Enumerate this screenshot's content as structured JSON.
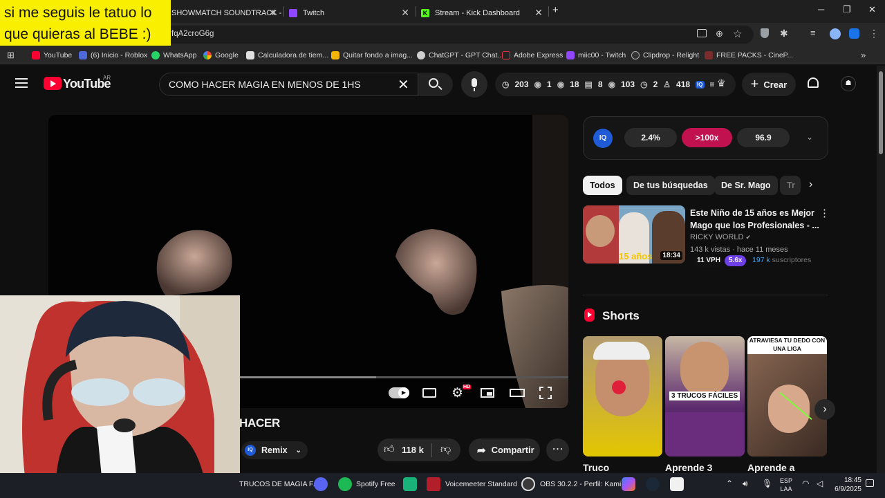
{
  "browser": {
    "tabs": [
      {
        "label": "SHOWMATCH SOUNDTRACK -"
      },
      {
        "label": "Twitch"
      },
      {
        "label": "Stream - Kick Dashboard"
      }
    ],
    "new_tab": "+",
    "url_fragment": "fqA2croG6g",
    "bookmarks": [
      "YouTube",
      "(6) Inicio - Roblox",
      "WhatsApp",
      "Google",
      "Calculadora de tiem...",
      "Quitar fondo a imag...",
      "ChatGPT - GPT Chat...",
      "Adobe Express",
      "miic00 - Twitch",
      "Clipdrop - Relight",
      "FREE PACKS - CineP..."
    ],
    "bookmarks_more": "»"
  },
  "overlay_note": {
    "line1": "si me seguis le tatuo lo",
    "line2": "que quieras al BEBE :)"
  },
  "youtube": {
    "logo_text": "YouTube",
    "country": "AR",
    "search_value": "COMO HACER MAGIA EN MENOS DE 1HS",
    "stats": [
      "203",
      "1",
      "18",
      "8",
      "103",
      "2",
      "418"
    ],
    "create_label": "Crear",
    "iq": {
      "badge": "IQ",
      "v1": "2.4%",
      "v2": ">100x",
      "v3": "96.9"
    },
    "chips": [
      "Todos",
      "De tus búsquedas",
      "De Sr. Mago",
      "Tr"
    ],
    "recommended": {
      "title_line1": "Este Niño de 15 años es Mejor",
      "title_line2": "Mago que los Profesionales - ...",
      "channel": "RICKY WORLD",
      "meta": "143 k vistas · hace 11 meses",
      "duration": "18:34",
      "thumb_text": "15 años",
      "vph": "11 VPH",
      "multiplier": "5.6x",
      "subs_number": "197 k",
      "subs_label": "suscriptores"
    },
    "shorts_label": "Shorts",
    "shorts": [
      {
        "title": "Truco"
      },
      {
        "title": "Aprende 3",
        "overlay": "3 TRUCOS FÁCILES"
      },
      {
        "title": "Aprende a",
        "overlay": "ATRAVIESA TU DEDO CON UNA LIGA"
      }
    ],
    "video_title_visible": "HACER",
    "remix_label": "Remix",
    "likes": "118 k",
    "share_label": "Compartir",
    "hd_badge": "HD"
  },
  "taskbar": {
    "items": [
      "TRUCOS DE MAGIA FÁ",
      "Spotify Free",
      "Voicemeeter Standard",
      "OBS 30.2.2 - Perfil: Kami"
    ],
    "lang_line1": "ESP",
    "lang_line2": "LAA",
    "time": "18:45",
    "date": "6/9/2025"
  },
  "colors": {
    "bg": "#0f0f0f",
    "yt_red": "#ff0033",
    "note_yellow": "#f9ef00",
    "pink": "#c1124f",
    "purple": "#6e3fe6"
  }
}
